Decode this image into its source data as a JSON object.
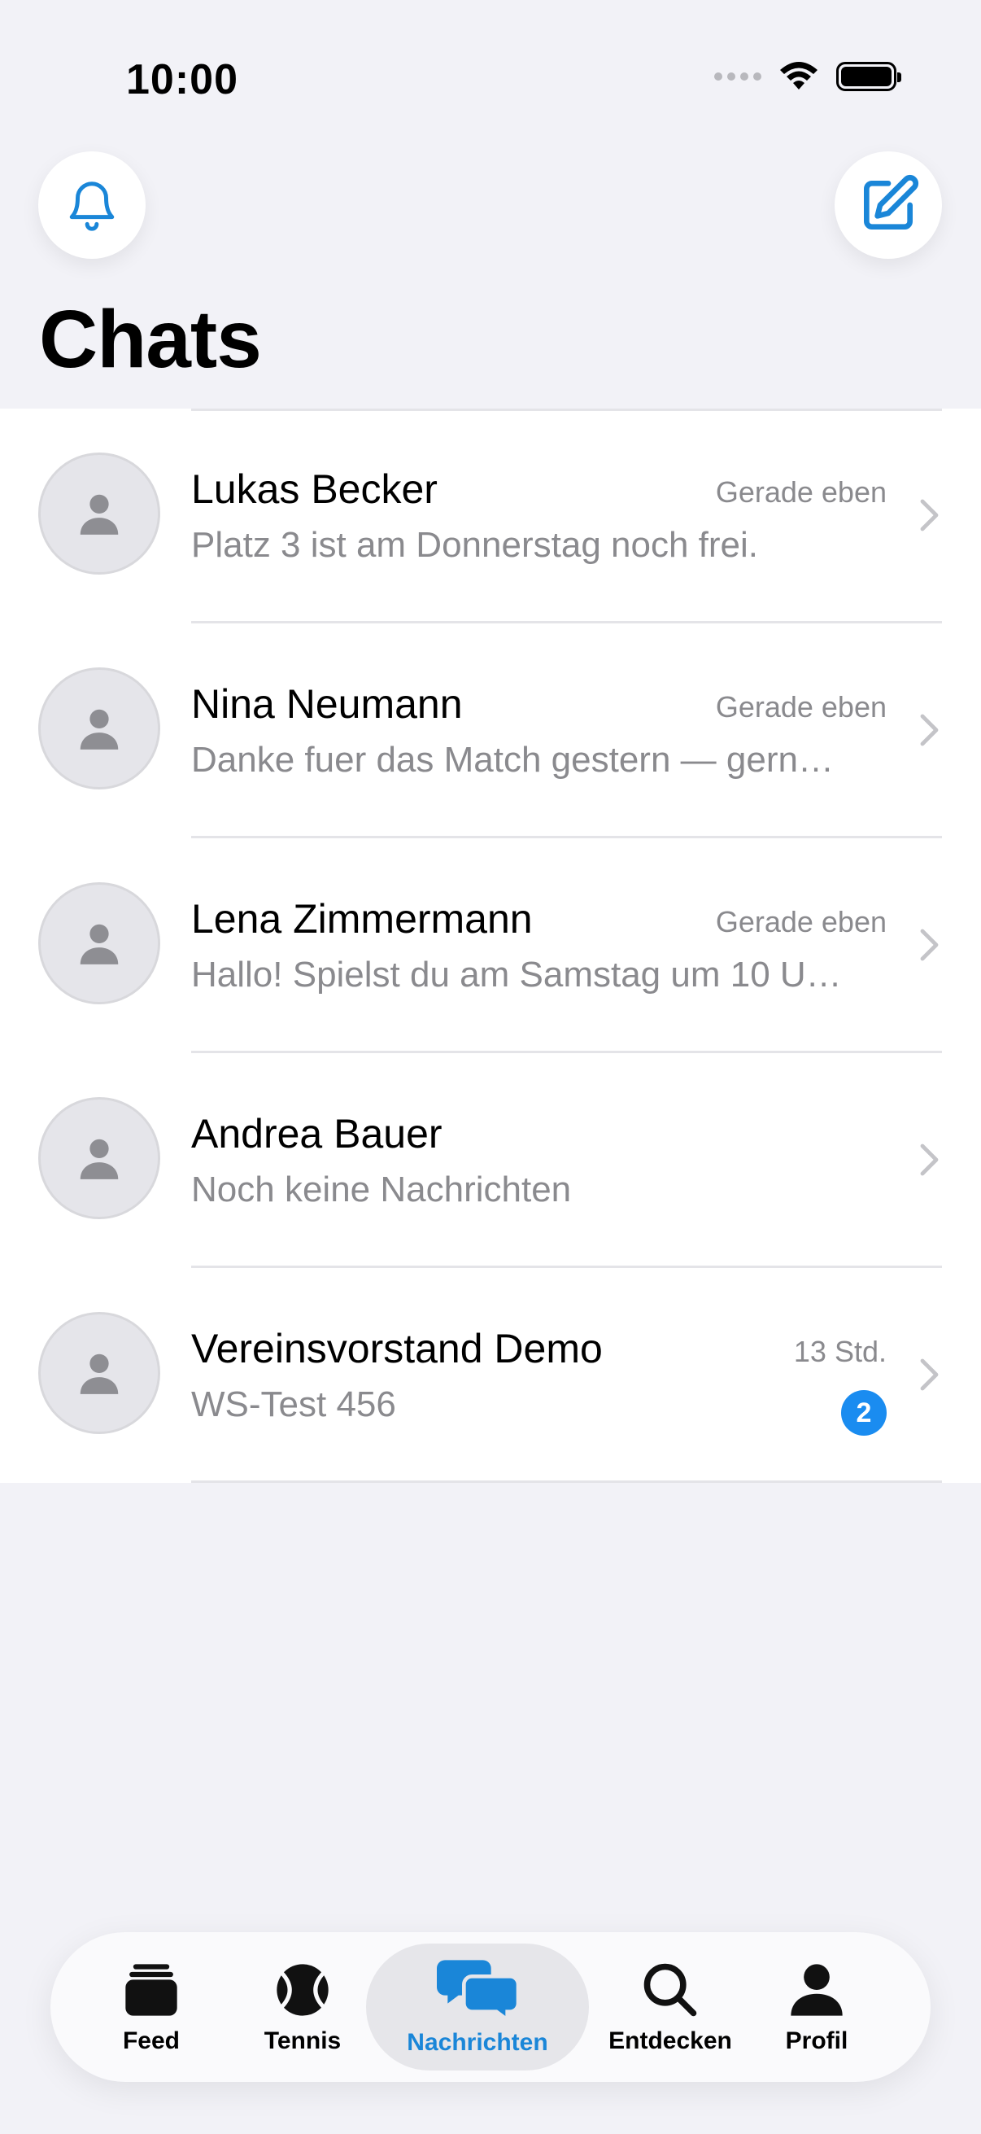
{
  "status_bar": {
    "time": "10:00"
  },
  "header": {
    "title": "Chats",
    "bell_icon": "bell-icon",
    "compose_icon": "compose-icon"
  },
  "colors": {
    "accent": "#1a86d8",
    "badge": "#1a8cf0",
    "background": "#f2f2f7",
    "secondary_text": "#8a8a8e"
  },
  "chats": [
    {
      "name": "Lukas Becker",
      "preview": "Platz 3 ist am Donnerstag noch frei.",
      "time": "Gerade eben",
      "unread": ""
    },
    {
      "name": "Nina Neumann",
      "preview": "Danke fuer das Match gestern — gern…",
      "time": "Gerade eben",
      "unread": ""
    },
    {
      "name": "Lena Zimmermann",
      "preview": "Hallo! Spielst du am Samstag um 10 U…",
      "time": "Gerade eben",
      "unread": ""
    },
    {
      "name": "Andrea Bauer",
      "preview": "Noch keine Nachrichten",
      "time": "",
      "unread": ""
    },
    {
      "name": "Vereinsvorstand Demo",
      "preview": "WS-Test 456",
      "time": "13 Std.",
      "unread": "2"
    }
  ],
  "tab_bar": {
    "active": "Nachrichten",
    "items": [
      {
        "label": "Feed",
        "icon": "stack-icon"
      },
      {
        "label": "Tennis",
        "icon": "tennis-ball-icon"
      },
      {
        "label": "Nachrichten",
        "icon": "chat-bubbles-icon"
      },
      {
        "label": "Entdecken",
        "icon": "search-icon"
      },
      {
        "label": "Profil",
        "icon": "person-icon"
      }
    ]
  }
}
